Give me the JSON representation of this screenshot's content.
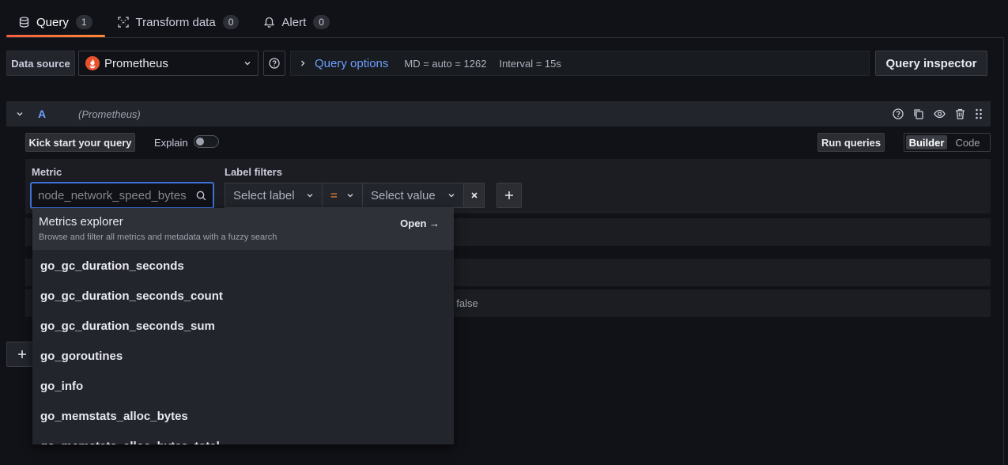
{
  "tabs": [
    {
      "label": "Query",
      "count": "1",
      "icon": "database-icon"
    },
    {
      "label": "Transform data",
      "count": "0",
      "icon": "transform-icon"
    },
    {
      "label": "Alert",
      "count": "0",
      "icon": "bell-icon"
    }
  ],
  "datasource": {
    "label": "Data source",
    "selected": "Prometheus"
  },
  "query_options": {
    "title": "Query options",
    "md": "MD = auto = 1262",
    "interval": "Interval = 15s"
  },
  "query_inspector_label": "Query inspector",
  "query_row": {
    "ref_id": "A",
    "datasource_name": "(Prometheus)"
  },
  "toolbar": {
    "kick_start_label": "Kick start your query",
    "explain_label": "Explain",
    "explain_on": false,
    "run_queries_label": "Run queries",
    "mode_builder": "Builder",
    "mode_code": "Code"
  },
  "builder": {
    "metric_label": "Metric",
    "metric_placeholder": "node_network_speed_bytes",
    "label_filters_label": "Label filters",
    "select_label_placeholder": "Select label",
    "operator": "=",
    "select_value_placeholder": "Select value"
  },
  "hidden_row_text": ": false",
  "dropdown": {
    "explorer_title": "Metrics explorer",
    "explorer_desc": "Browse and filter all metrics and metadata with a fuzzy search",
    "explorer_open": "Open →",
    "options": [
      "go_gc_duration_seconds",
      "go_gc_duration_seconds_count",
      "go_gc_duration_seconds_sum",
      "go_goroutines",
      "go_info",
      "go_memstats_alloc_bytes",
      "go_memstats_alloc_bytes_total"
    ]
  },
  "colors": {
    "accent_blue": "#6e9fff",
    "tab_active_gradient": [
      "#f55f3e",
      "#ff8833"
    ],
    "operator_orange": "#ff8833",
    "focus_border": "#3d71d9"
  }
}
